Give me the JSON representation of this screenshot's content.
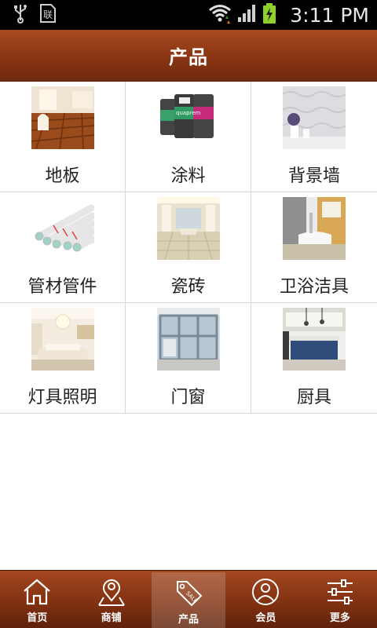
{
  "status_bar": {
    "time": "3:11 PM",
    "icons": [
      "usb-icon",
      "sim-icon",
      "wifi-icon",
      "signal-icon",
      "battery-charging-icon"
    ]
  },
  "header": {
    "title": "产品"
  },
  "categories": [
    {
      "label": "地板",
      "image": "wood-floor"
    },
    {
      "label": "涂料",
      "image": "paint-cans"
    },
    {
      "label": "背景墙",
      "image": "wallpaper"
    },
    {
      "label": "管材管件",
      "image": "pipes"
    },
    {
      "label": "瓷砖",
      "image": "tiled-room"
    },
    {
      "label": "卫浴洁具",
      "image": "bathroom"
    },
    {
      "label": "灯具照明",
      "image": "living-room-lights"
    },
    {
      "label": "门窗",
      "image": "windows"
    },
    {
      "label": "厨具",
      "image": "kitchen"
    }
  ],
  "bottom_nav": [
    {
      "label": "首页",
      "icon": "home-icon",
      "active": false
    },
    {
      "label": "商铺",
      "icon": "map-pin-icon",
      "active": false
    },
    {
      "label": "产品",
      "icon": "price-tag-icon",
      "active": true
    },
    {
      "label": "会员",
      "icon": "member-icon",
      "active": false
    },
    {
      "label": "更多",
      "icon": "sliders-icon",
      "active": false
    }
  ],
  "colors": {
    "header": "#8a3512",
    "nav": "#7e3010"
  }
}
